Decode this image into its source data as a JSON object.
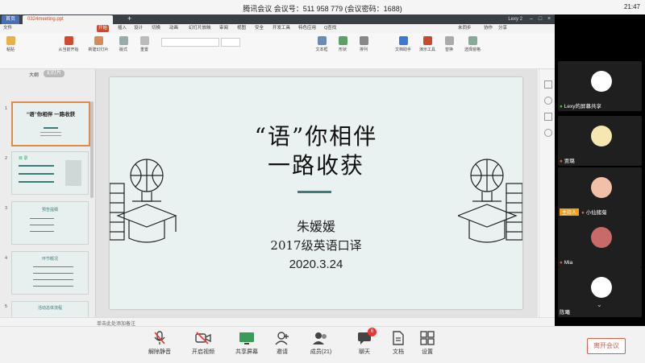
{
  "meeting": {
    "title": "腾讯会议  会议号：511 958 779   (会议密码：1688)",
    "time": "21:47"
  },
  "wps": {
    "tabs": {
      "home": "首页",
      "doc": "0324meeting.ppt",
      "plus": "+"
    },
    "user": "Lexy 2",
    "menu": [
      "文件",
      "开始",
      "插入",
      "设计",
      "切换",
      "动画",
      "幻灯片放映",
      "审阅",
      "视图",
      "安全",
      "开发工具",
      "特色应用",
      "Q查找"
    ],
    "menu_active_index": 1,
    "toolbar_right": [
      "未同步",
      "协作",
      "分享"
    ],
    "toolbar": [
      "粘贴",
      "从当前开始",
      "新建幻灯片",
      "版式",
      "重置",
      "文本框",
      "形状",
      "排列",
      "文档助手",
      "演示工具",
      "替换",
      "选择窗格"
    ],
    "left_panel": {
      "tab_outline": "大纲",
      "tab_slides": "幻灯片",
      "add": "+"
    },
    "thumbs": [
      {
        "num": "1",
        "title": "“语”你相伴 一路收获"
      },
      {
        "num": "2",
        "title": "目 录"
      },
      {
        "num": "3",
        "title": "预告提纲"
      },
      {
        "num": "4",
        "title": "环节概况"
      },
      {
        "num": "5",
        "title": "活动总体流程"
      }
    ],
    "status": "单击此处添加备注"
  },
  "slide": {
    "title_line1": "“语”你相伴",
    "title_line2": "一路收获",
    "name": "朱媛媛",
    "class": "2017级英语口译",
    "date": "2020.3.24"
  },
  "participants": [
    {
      "name": "Lexy的屏幕共享",
      "mic": "on",
      "host": false
    },
    {
      "name": "贾璐",
      "mic": "off",
      "host": false
    },
    {
      "name": "小仙猪菊",
      "mic": "off",
      "host": true,
      "host_label": "主持人"
    },
    {
      "name": "Mia",
      "mic": "off",
      "host": false
    },
    {
      "name": "陈曦",
      "mic": "off",
      "host": false
    }
  ],
  "bottom": {
    "unmute": "解除静音",
    "video": "开启视频",
    "share": "共享屏幕",
    "invite": "邀请",
    "members": "成员(21)",
    "chat": "聊天",
    "chat_badge": "6",
    "docs": "文档",
    "settings": "设置",
    "leave": "离开会议"
  },
  "colors": {
    "accent": "#c84a2e",
    "teal": "#3d7b7a",
    "host": "#f0a020",
    "leave": "#e15a4a"
  }
}
